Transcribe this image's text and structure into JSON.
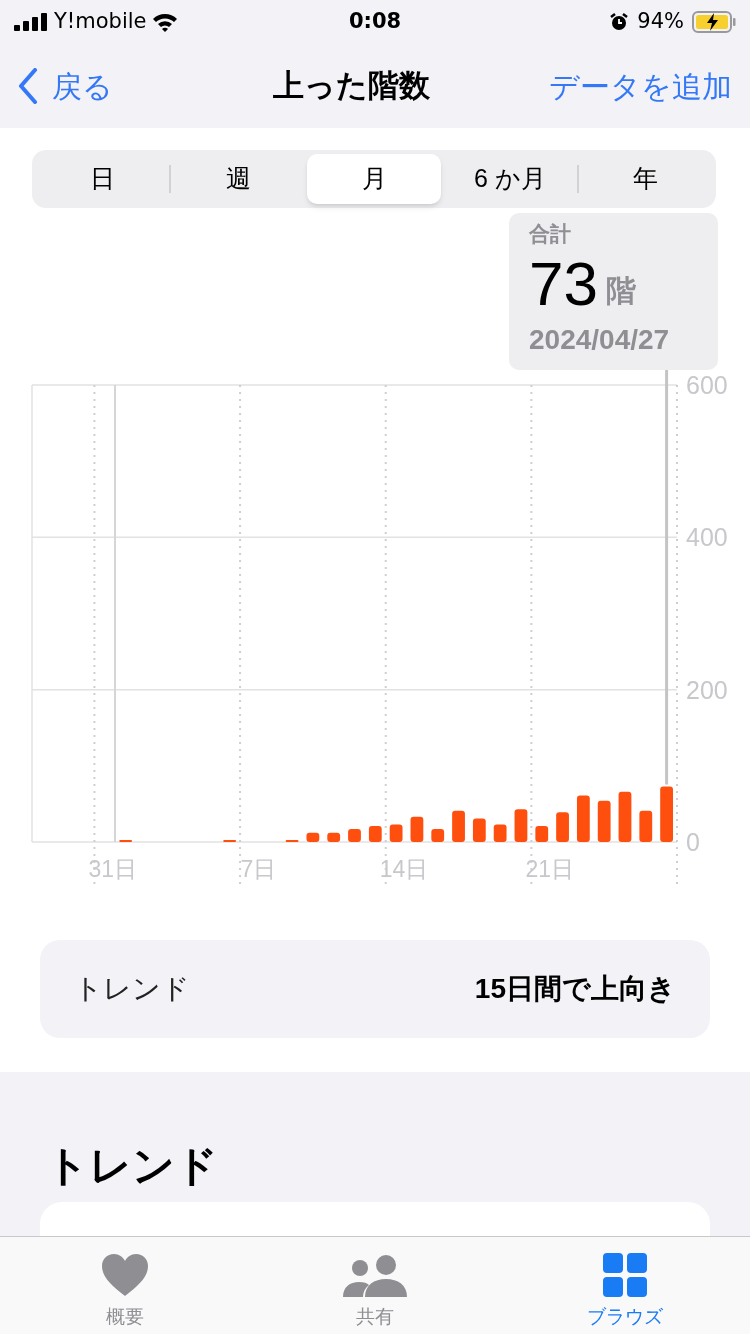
{
  "status_bar": {
    "carrier": "Y!mobile",
    "time": "0:08",
    "battery": "94%"
  },
  "nav": {
    "back": "戻る",
    "title": "上った階数",
    "action": "データを追加"
  },
  "segments": [
    {
      "label": "日",
      "selected": false
    },
    {
      "label": "週",
      "selected": false
    },
    {
      "label": "月",
      "selected": true
    },
    {
      "label": "6 か月",
      "selected": false
    },
    {
      "label": "年",
      "selected": false
    }
  ],
  "summary": {
    "label": "合計",
    "value": "73",
    "unit": "階",
    "date": "2024/04/27"
  },
  "chart": {
    "chart_data": {
      "type": "bar",
      "categories": [
        null,
        null,
        null,
        "31日",
        null,
        null,
        null,
        null,
        null,
        null,
        "7日",
        null,
        null,
        null,
        null,
        null,
        null,
        "14日",
        null,
        null,
        null,
        null,
        null,
        null,
        "21日",
        null,
        null,
        null,
        null,
        null,
        null
      ],
      "series": [
        {
          "color": "#ff4f0f",
          "values": [
            null,
            null,
            null,
            null,
            1,
            null,
            null,
            null,
            null,
            2,
            null,
            null,
            1,
            12,
            12,
            17,
            21,
            23,
            33,
            17,
            41,
            31,
            23,
            43,
            21,
            39,
            61,
            54,
            66,
            41,
            73
          ]
        }
      ],
      "ylim": [
        0,
        600
      ],
      "yticks": [
        0,
        200,
        400,
        600
      ],
      "grid": true
    }
  },
  "trend_row": {
    "label": "トレンド",
    "value": "15日間で上向き"
  },
  "section": {
    "heading": "トレンド"
  },
  "tab_bar": [
    {
      "kind": "heart",
      "label": "概要",
      "selected": false
    },
    {
      "kind": "people",
      "label": "共有",
      "selected": false
    },
    {
      "kind": "grid",
      "label": "ブラウズ",
      "selected": true
    }
  ]
}
